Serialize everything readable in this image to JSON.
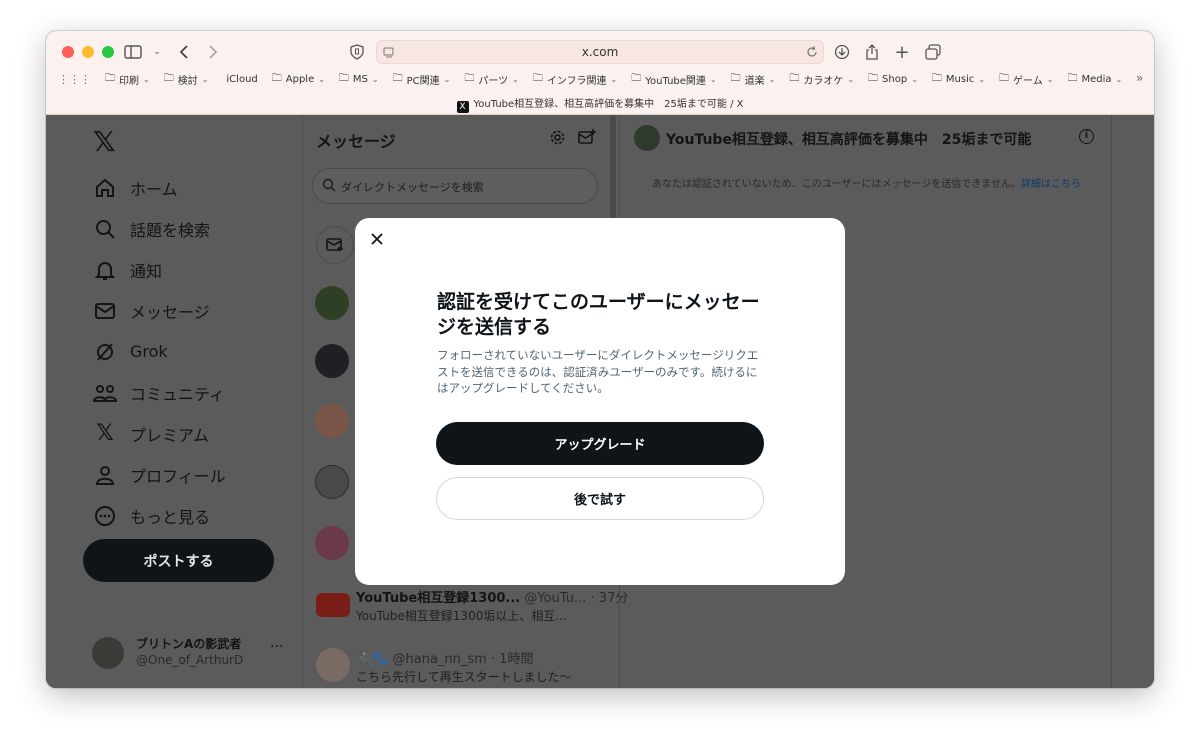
{
  "browser": {
    "url": "x.com",
    "tab_title": "YouTube相互登録、相互高評価を募集中　25垢まで可能 / X",
    "bookmarks": [
      "印刷",
      "検討",
      "iCloud",
      "Apple",
      "MS",
      "PC関連",
      "パーツ",
      "インフラ関連",
      "YouTube関連",
      "道楽",
      "カラオケ",
      "Shop",
      "Music",
      "ゲーム",
      "Media"
    ],
    "more": "»"
  },
  "nav": {
    "logo": "𝕏",
    "items": [
      "ホーム",
      "話題を検索",
      "通知",
      "メッセージ",
      "Grok",
      "コミュニティ",
      "プレミアム",
      "プロフィール",
      "もっと見る"
    ],
    "post_label": "ポストする",
    "account_name": "ブリトンAの影武者",
    "account_handle": "@One_of_ArthurD",
    "account_more": "···"
  },
  "messages": {
    "title": "メッセージ",
    "search_placeholder": "ダイレクトメッセージを検索",
    "conversations": [
      {
        "name": "YouTube相互登録1300...",
        "handle": "@YouTu...",
        "time": "· 37分",
        "preview": "YouTube相互登録1300垢以上、相互..."
      },
      {
        "name": "🐈‍⬛🐾",
        "handle": "@hana_nn_sm",
        "time": "· 1時間",
        "preview": "こちら先行して再生スタートしました〜"
      }
    ]
  },
  "conversation": {
    "title": "YouTube相互登録、相互高評価を募集中　25垢まで可能",
    "notice": "あなたは認証されていないため、このユーザーにはメッセージを送信できません。",
    "notice_link": "詳細はこちら"
  },
  "modal": {
    "title": "認証を受けてこのユーザーにメッセージを送信する",
    "description": "フォローされていないユーザーにダイレクトメッセージリクエストを送信できるのは、認証済みユーザーのみです。続けるにはアップグレードしてください。",
    "primary_label": "アップグレード",
    "secondary_label": "後で試す"
  }
}
